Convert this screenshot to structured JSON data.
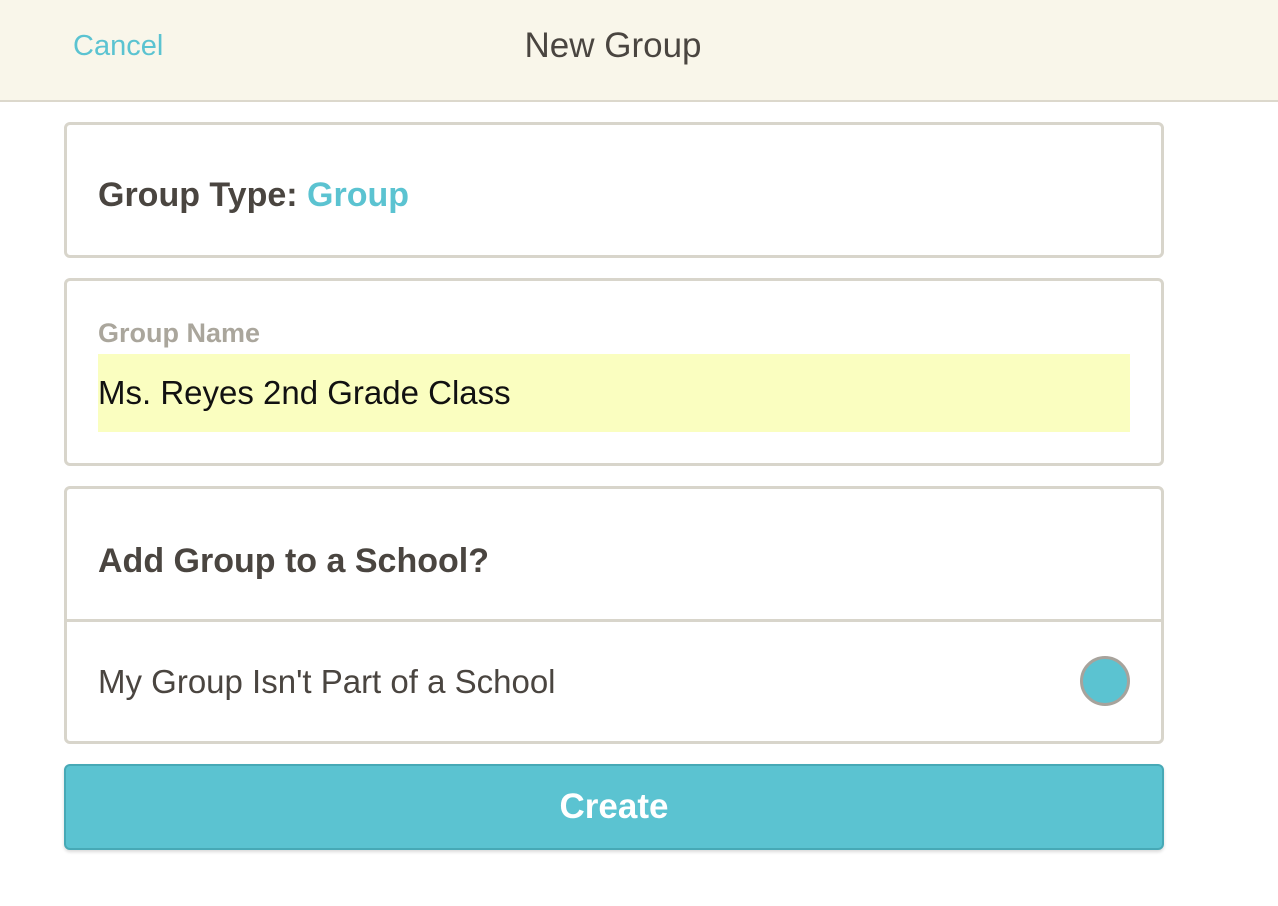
{
  "header": {
    "cancel_label": "Cancel",
    "title": "New Group"
  },
  "group_type": {
    "label": "Group Type:",
    "value": "Group"
  },
  "group_name": {
    "label": "Group Name",
    "value": "Ms. Reyes 2nd Grade Class"
  },
  "school": {
    "question": "Add Group to a School?",
    "options": [
      {
        "label": "My Group Isn't Part of a School",
        "selected": true
      }
    ]
  },
  "create_label": "Create",
  "colors": {
    "accent": "#5bc3d1",
    "header_bg": "#f9f6ea",
    "input_highlight": "#fafec0"
  }
}
